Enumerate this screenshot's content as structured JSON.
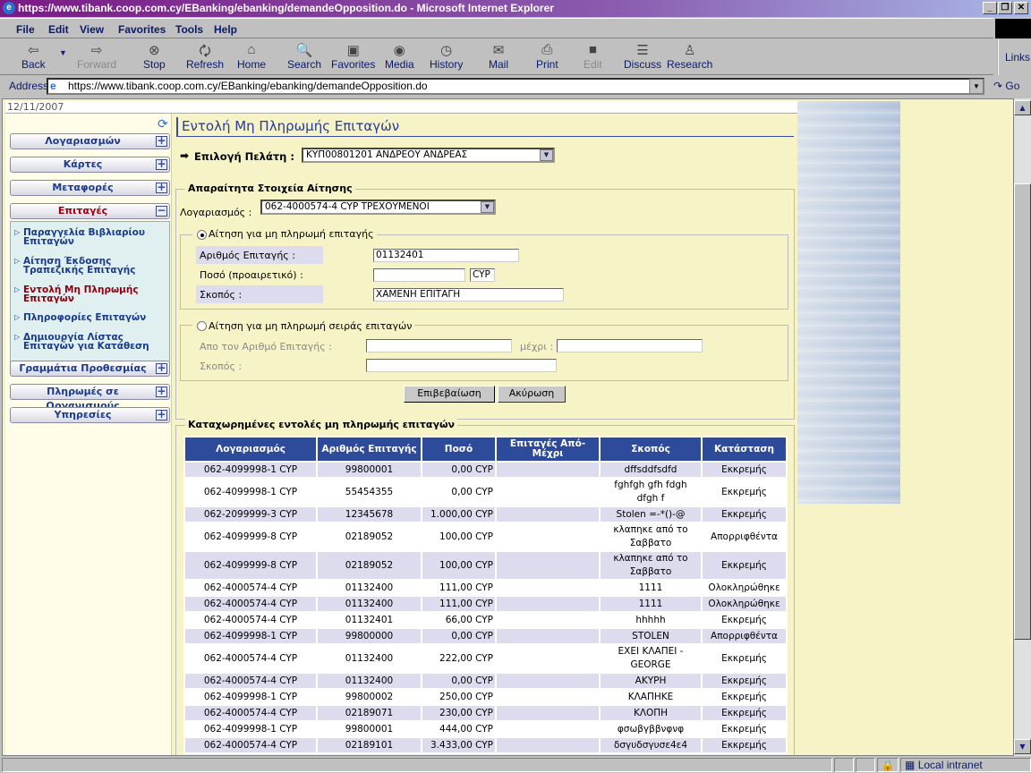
{
  "window": {
    "title": "https://www.tibank.coop.com.cy/EBanking/ebanking/demandeOpposition.do - Microsoft Internet Explorer"
  },
  "menu": [
    "File",
    "Edit",
    "View",
    "Favorites",
    "Tools",
    "Help"
  ],
  "toolbar": {
    "back": "Back",
    "forward": "Forward",
    "stop": "Stop",
    "refresh": "Refresh",
    "home": "Home",
    "search": "Search",
    "favorites": "Favorites",
    "media": "Media",
    "history": "History",
    "mail": "Mail",
    "print": "Print",
    "edit": "Edit",
    "discuss": "Discuss",
    "research": "Research",
    "links": "Links"
  },
  "address": {
    "label": "Address",
    "url": "https://www.tibank.coop.com.cy/EBanking/ebanking/demandeOpposition.do",
    "go": "Go"
  },
  "date": "12/11/2007",
  "sidebar": {
    "sections": [
      "Λογαριασμών",
      "Κάρτες",
      "Μεταφορές",
      "Επιταγές",
      "Γραμμάτια Προθεσμίας",
      "Πληρωμές σε Οργανισμούς",
      "Υπηρεσίες"
    ],
    "expanded": "Επιταγές",
    "subitems": [
      "Παραγγελία Βιβλιαρίου Επιταγών",
      "Αίτηση Έκδοσης Τραπεζικής Επιταγής",
      "Εντολή Μη Πληρωμής Επιταγών",
      "Πληροφορίες Επιταγών",
      "Δημιουργία Λίστας Επιταγών για Κατάθεση"
    ],
    "active_subitem": "Εντολή Μη Πληρωμής Επιταγών"
  },
  "main": {
    "title": "Εντολή Μη Πληρωμής Επιταγών",
    "client_label": "Επιλογή Πελάτη :",
    "client_value": "ΚΥΠ00801201 ΑΝΔΡΕΟΥ ΑΝΔΡΕΑΣ",
    "required_legend": "Απαραίτητα Στοιχεία Αίτησης",
    "account_label": "Λογαριασμός :",
    "account_value": "062-4000574-4 CYP ΤΡΕΧΟΥΜΕΝΟΙ",
    "single": {
      "legend": "Αίτηση για μη πληρωμή επιταγής",
      "selected": true,
      "cheque_label": "Αριθμός Επιταγής :",
      "cheque_value": "01132401",
      "amount_label": "Ποσό (προαιρετικό) :",
      "amount_value": "",
      "currency": "CYP",
      "reason_label": "Σκοπός :",
      "reason_value": "ΧΑΜΕΝΗ ΕΠΙΤΑΓΗ"
    },
    "range": {
      "legend": "Αίτηση για μη πληρωμή σειράς επιταγών",
      "selected": false,
      "from_label": "Απο τον Αριθμό Επιταγής :",
      "to_label": "μέχρι :",
      "reason_label": "Σκοπός :"
    },
    "confirm": "Επιβεβαίωση",
    "cancel": "Ακύρωση",
    "list_legend": "Καταχωρημένες εντολές μη πληρωμής επιταγών",
    "columns": [
      "Λογαριασμός",
      "Αριθμός Επιταγής",
      "Ποσό",
      "Επιταγές Από-Μέχρι",
      "Σκοπός",
      "Κατάσταση"
    ],
    "rows": [
      [
        "062-4099998-1 CYP",
        "99800001",
        "0,00 CYP",
        "",
        "dffsddfsdfd",
        "Εκκρεμής"
      ],
      [
        "062-4099998-1 CYP",
        "55454355",
        "0,00 CYP",
        "",
        "fghfgh gfh fdgh dfgh f",
        "Εκκρεμής"
      ],
      [
        "062-2099999-3 CYP",
        "12345678",
        "1.000,00 CYP",
        "",
        "Stolen =-*()-@",
        "Εκκρεμής"
      ],
      [
        "062-4099999-8 CYP",
        "02189052",
        "100,00 CYP",
        "",
        "κλαπηκε από το Σαββατο",
        "Απορριφθέντα"
      ],
      [
        "062-4099999-8 CYP",
        "02189052",
        "100,00 CYP",
        "",
        "κλαπηκε από το Σαββατο",
        "Εκκρεμής"
      ],
      [
        "062-4000574-4 CYP",
        "01132400",
        "111,00 CYP",
        "",
        "1111",
        "Ολοκληρώθηκε"
      ],
      [
        "062-4000574-4 CYP",
        "01132400",
        "111,00 CYP",
        "",
        "1111",
        "Ολοκληρώθηκε"
      ],
      [
        "062-4000574-4 CYP",
        "01132401",
        "66,00 CYP",
        "",
        "hhhhh",
        "Εκκρεμής"
      ],
      [
        "062-4099998-1 CYP",
        "99800000",
        "0,00 CYP",
        "",
        "STOLEN",
        "Απορριφθέντα"
      ],
      [
        "062-4000574-4 CYP",
        "01132400",
        "222,00 CYP",
        "",
        "ΕΧΕΙ ΚΛΑΠΕΙ - GEORGE",
        "Εκκρεμής"
      ],
      [
        "062-4000574-4 CYP",
        "01132400",
        "0,00 CYP",
        "",
        "ΑΚΥΡΗ",
        "Εκκρεμής"
      ],
      [
        "062-4099998-1 CYP",
        "99800002",
        "250,00 CYP",
        "",
        "ΚΛΑΠΗΚΕ",
        "Εκκρεμής"
      ],
      [
        "062-4000574-4 CYP",
        "02189071",
        "230,00 CYP",
        "",
        "ΚΛΟΠΗ",
        "Εκκρεμής"
      ],
      [
        "062-4099998-1 CYP",
        "99800001",
        "444,00 CYP",
        "",
        "φσωβγββνφνφ",
        "Εκκρεμής"
      ],
      [
        "062-4000574-4 CYP",
        "02189101",
        "3.433,00 CYP",
        "",
        "δσγυδσγυσε4ε4",
        "Εκκρεμής"
      ]
    ]
  },
  "status": {
    "zone": "Local intranet"
  },
  "colors": {
    "header": "#2e4b9b",
    "page_bg": "#f6f4c6",
    "title_text": "#2a3a9a",
    "active_item": "#8a0010"
  }
}
